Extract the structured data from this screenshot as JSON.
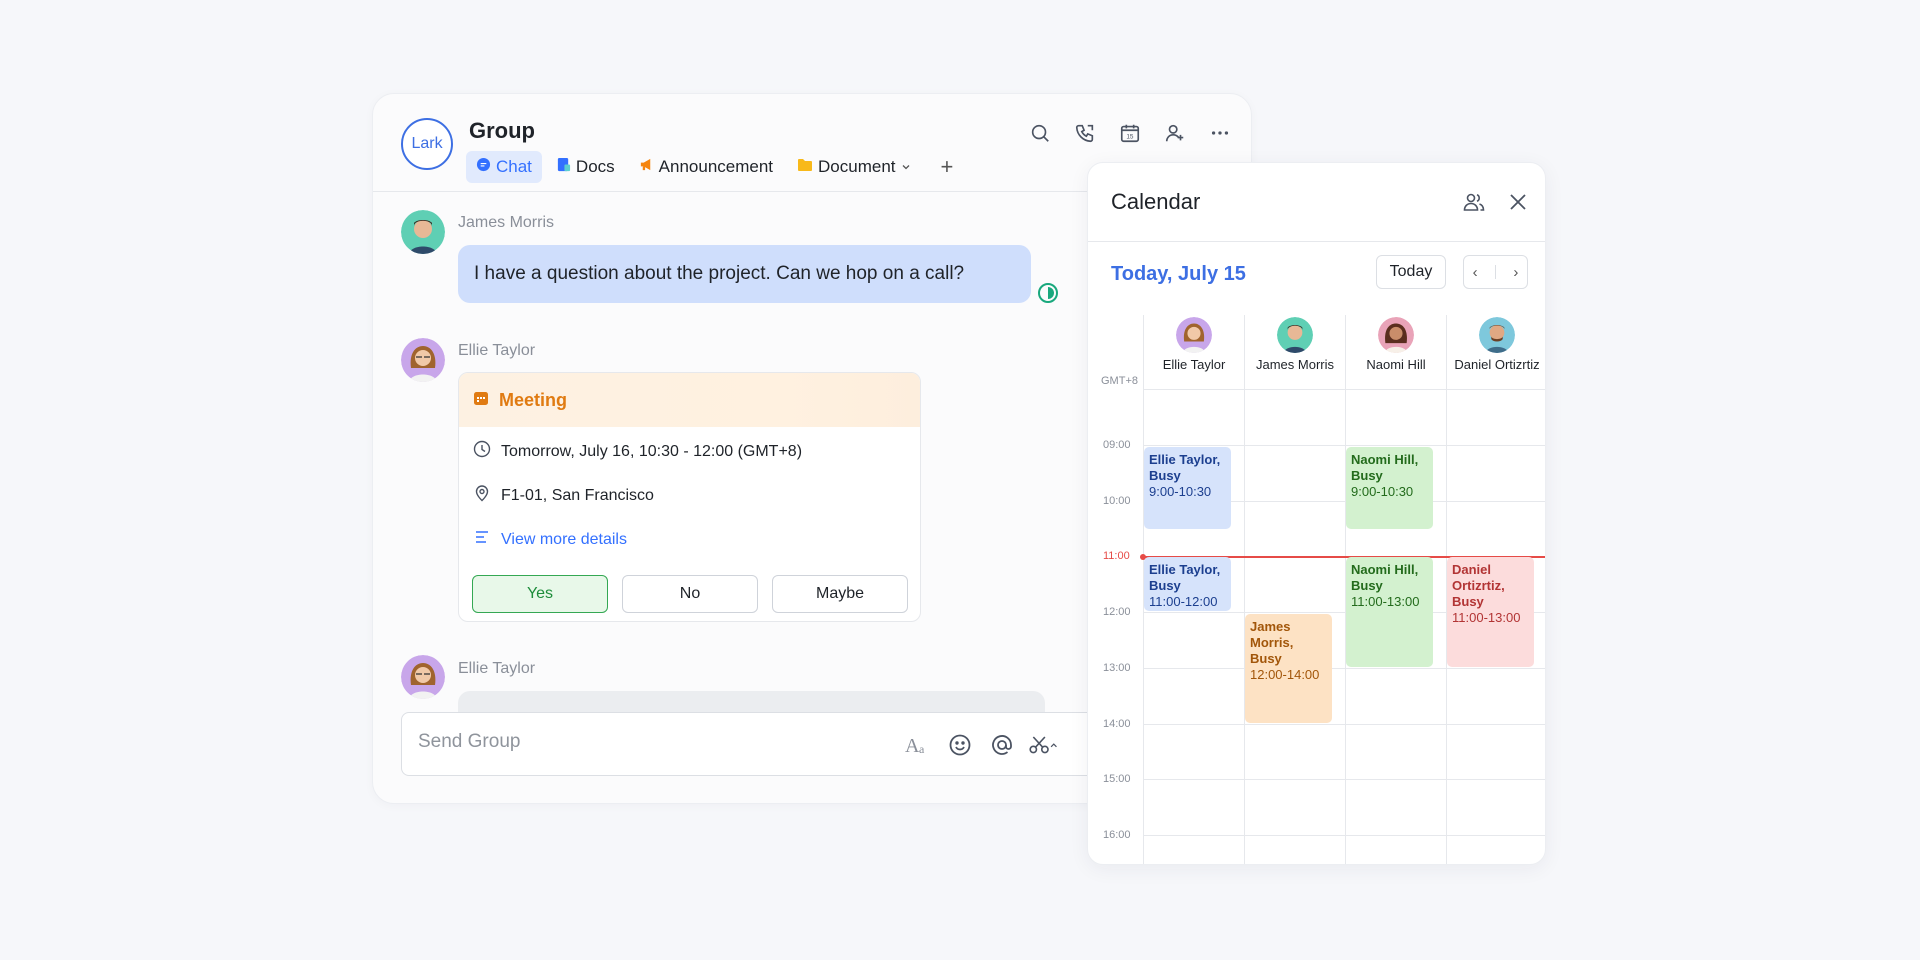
{
  "chat": {
    "logo": "Lark",
    "title": "Group",
    "header_icons": [
      "search-icon",
      "call-icon",
      "calendar-icon",
      "add-member-icon",
      "more-icon"
    ],
    "tabs": [
      {
        "label": "Chat",
        "icon": "chat-icon",
        "color": "#3370ff",
        "active": true
      },
      {
        "label": "Docs",
        "icon": "docs-icon",
        "color": "#3370ff",
        "active": false
      },
      {
        "label": "Announcement",
        "icon": "megaphone-icon",
        "color": "#f5850f",
        "active": false
      },
      {
        "label": "Document",
        "icon": "folder-icon",
        "color": "#f8b91a",
        "active": false
      }
    ],
    "add_tab": "+",
    "messages": [
      {
        "sender": "James Morris",
        "text": "I have a question about the project. Can we hop on a call?"
      },
      {
        "sender": "Ellie Taylor"
      },
      {
        "sender": "Ellie Taylor"
      }
    ],
    "meeting": {
      "title": "Meeting",
      "time": "Tomorrow, July 16, 10:30 - 12:00 (GMT+8)",
      "location": "F1-01, San Francisco",
      "details_link": "View more details",
      "buttons": {
        "yes": "Yes",
        "no": "No",
        "maybe": "Maybe"
      }
    },
    "input": {
      "placeholder": "Send Group"
    }
  },
  "calendar": {
    "title": "Calendar",
    "date": "Today, July 15",
    "today_button": "Today",
    "timezone": "GMT+8",
    "hours": [
      "09:00",
      "10:00",
      "11:00",
      "12:00",
      "13:00",
      "14:00",
      "15:00",
      "16:00"
    ],
    "people": [
      "Ellie Taylor",
      "James Morris",
      "Naomi Hill",
      "Daniel Ortizrtiz"
    ],
    "events": [
      {
        "title": "Ellie Taylor, Busy",
        "time": "9:00-10:30",
        "color": "#d6e3fb"
      },
      {
        "title": "Ellie Taylor, Busy",
        "time": "11:00-12:00",
        "color": "#d6e3fb"
      },
      {
        "title": "James Morris, Busy",
        "time": "12:00-14:00",
        "color": "#fde2c4"
      },
      {
        "title": "Naomi Hill, Busy",
        "time": "9:00-10:30",
        "color": "#d3f1cf"
      },
      {
        "title": "Naomi Hill, Busy",
        "time": "11:00-13:00",
        "color": "#d3f1cf"
      },
      {
        "title": "Daniel Ortizrtiz, Busy",
        "time": "11:00-13:00",
        "color": "#fcdcdc"
      }
    ],
    "current_time_color": "#e64b47"
  }
}
